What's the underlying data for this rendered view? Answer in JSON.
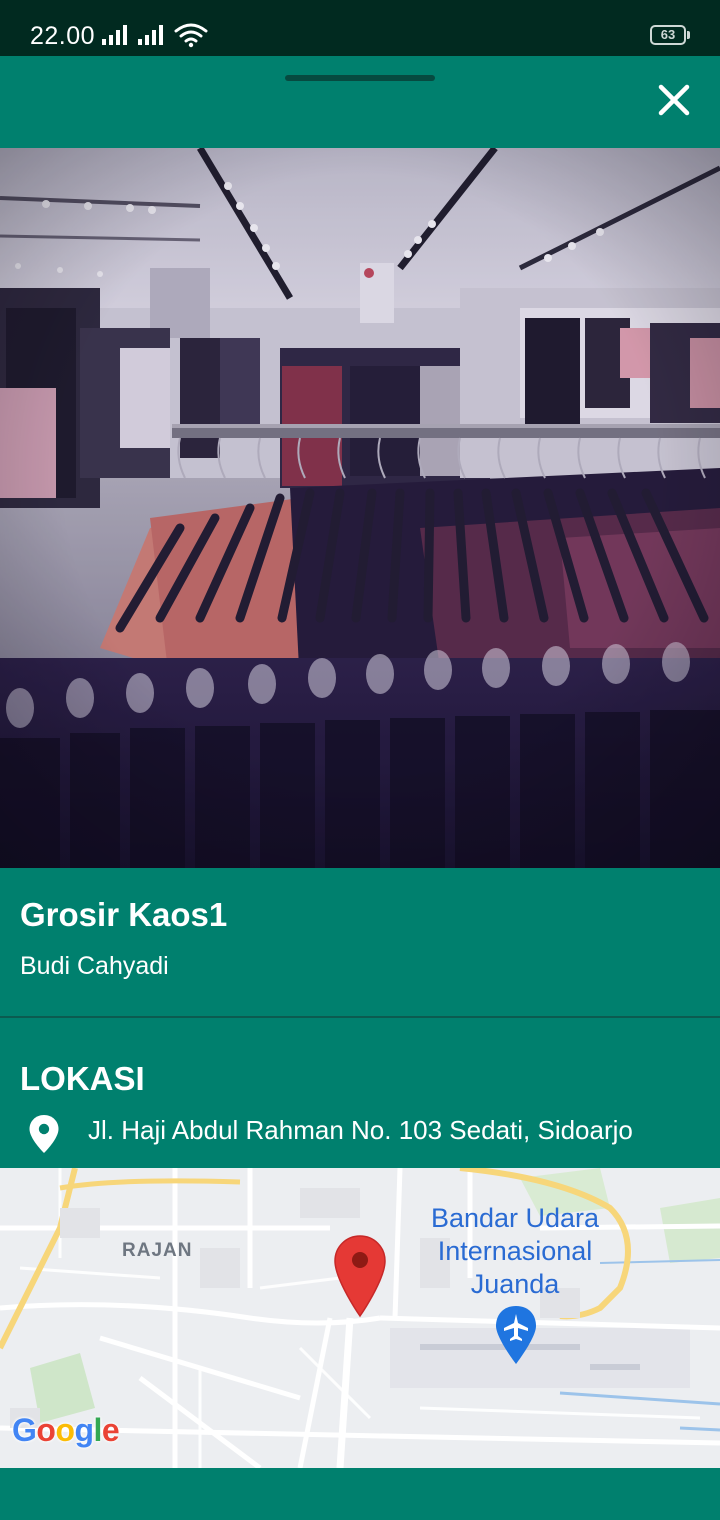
{
  "status_bar": {
    "time": "22.00",
    "battery": "63",
    "icons": [
      "signal-icon",
      "signal-icon",
      "wifi-icon",
      "battery-icon"
    ]
  },
  "header": {
    "close_icon": "close-icon"
  },
  "store": {
    "name": "Grosir Kaos1",
    "owner": "Budi Cahyadi"
  },
  "location": {
    "heading": "LOKASI",
    "address": "Jl. Haji Abdul Rahman No. 103 Sedati, Sidoarjo",
    "icon": "location-pin-icon"
  },
  "map": {
    "area_label": "RAJAN",
    "airport_label": "Bandar Udara Internasional Juanda",
    "airport_label_lines": [
      "Bandar Udara",
      "Internasional",
      "Juanda"
    ],
    "provider": "Google"
  },
  "colors": {
    "primary": "#00806E",
    "status_bar": "#012a20",
    "marker": "#E53935",
    "airport": "#2a6bd3"
  }
}
